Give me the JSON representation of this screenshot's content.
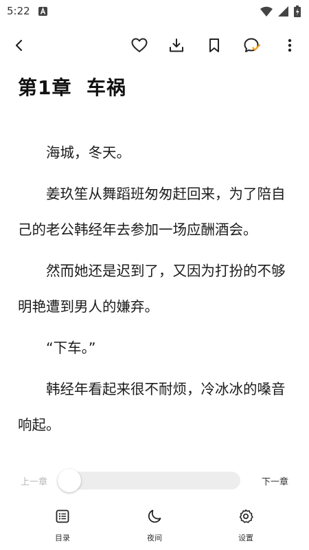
{
  "status_bar": {
    "time": "5:22",
    "icons": [
      "notification-a-icon",
      "wifi-icon",
      "signal-icon",
      "battery-icon"
    ]
  },
  "toolbar": {
    "icons": [
      "back-arrow-icon",
      "heart-icon",
      "download-icon",
      "bookmark-icon",
      "comment-check-icon",
      "more-vertical-icon"
    ],
    "accent_color": "#f5a623"
  },
  "chapter": {
    "title": "第1章  车祸",
    "paragraphs": [
      "海城，冬天。",
      "姜玖笙从舞蹈班匆匆赶回来，为了陪自己的老公韩经年去参加一场应酬酒会。",
      "然而她还是迟到了，又因为打扮的不够明艳遭到男人的嫌弃。",
      "“下车。”",
      "韩经年看起来很不耐烦，冷冰冰的嗓音响起。"
    ]
  },
  "chapter_nav": {
    "prev_label": "上一章",
    "next_label": "下一章",
    "progress": 0
  },
  "bottom_bar": {
    "items": [
      {
        "label": "目录",
        "icon": "table-of-contents-icon"
      },
      {
        "label": "夜间",
        "icon": "moon-icon"
      },
      {
        "label": "设置",
        "icon": "gear-icon"
      }
    ]
  }
}
